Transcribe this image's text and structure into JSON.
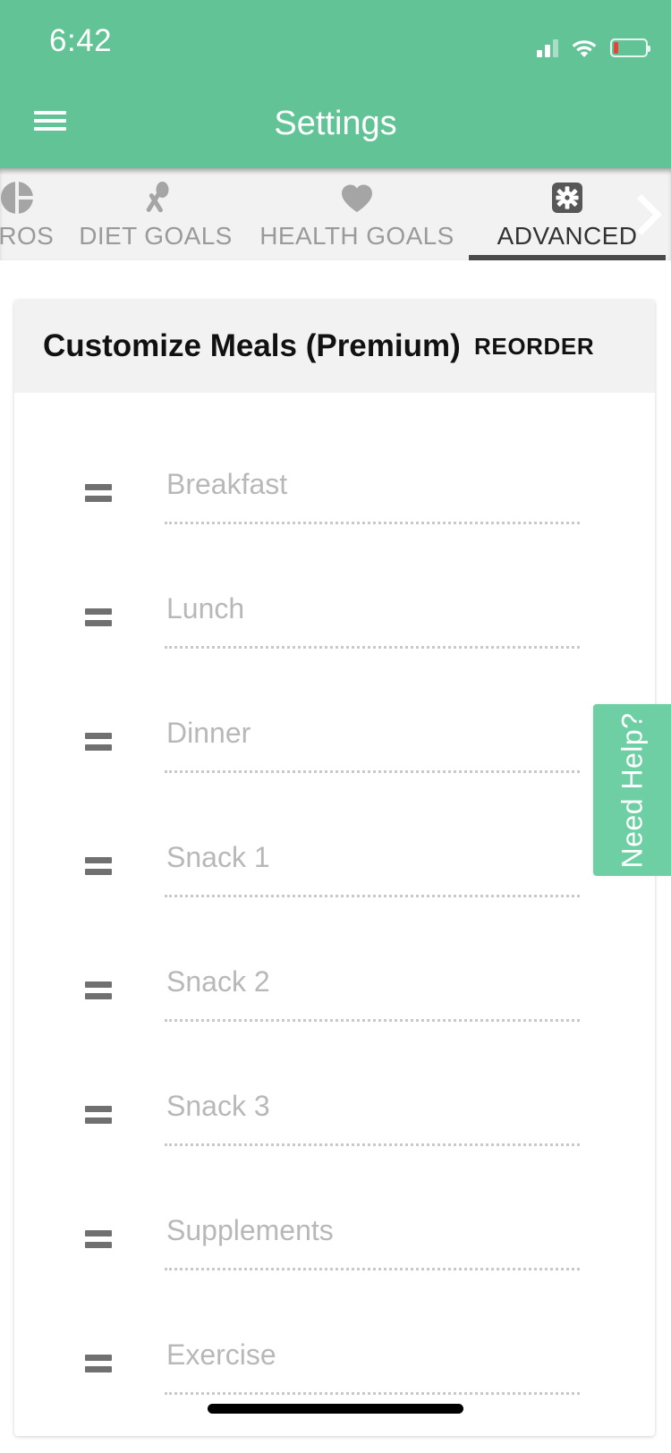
{
  "status_bar": {
    "time": "6:42",
    "signal_icon": "signal-bars-icon",
    "wifi_icon": "wifi-icon",
    "battery_icon": "battery-low-icon",
    "battery_level_percent": 14
  },
  "nav_bar": {
    "menu_icon": "hamburger-menu-icon",
    "title": "Settings"
  },
  "tabs": {
    "scroll_next_icon": "chevron-right-icon",
    "items": [
      {
        "label": "CROS",
        "icon": "pie-chart-icon",
        "active": false
      },
      {
        "label": "DIET GOALS",
        "icon": "fork-spoon-icon",
        "active": false
      },
      {
        "label": "HEALTH GOALS",
        "icon": "heart-icon",
        "active": false
      },
      {
        "label": "ADVANCED",
        "icon": "gear-icon",
        "active": true
      }
    ]
  },
  "card": {
    "title": "Customize Meals (Premium)",
    "reorder_label": "REORDER",
    "meals": [
      {
        "placeholder": "Breakfast",
        "value": ""
      },
      {
        "placeholder": "Lunch",
        "value": ""
      },
      {
        "placeholder": "Dinner",
        "value": ""
      },
      {
        "placeholder": "Snack 1",
        "value": ""
      },
      {
        "placeholder": "Snack 2",
        "value": ""
      },
      {
        "placeholder": "Snack 3",
        "value": ""
      },
      {
        "placeholder": "Supplements",
        "value": ""
      },
      {
        "placeholder": "Exercise",
        "value": ""
      }
    ]
  },
  "need_help": {
    "label": "Need Help?"
  },
  "colors": {
    "brand_green": "#62c496",
    "help_tab_green": "#6fcfa4",
    "card_header_gray": "#f2f2f2",
    "tab_inactive_text": "#9a9a9a",
    "tab_active_text": "#333333",
    "battery_low_red": "#e8433a"
  }
}
